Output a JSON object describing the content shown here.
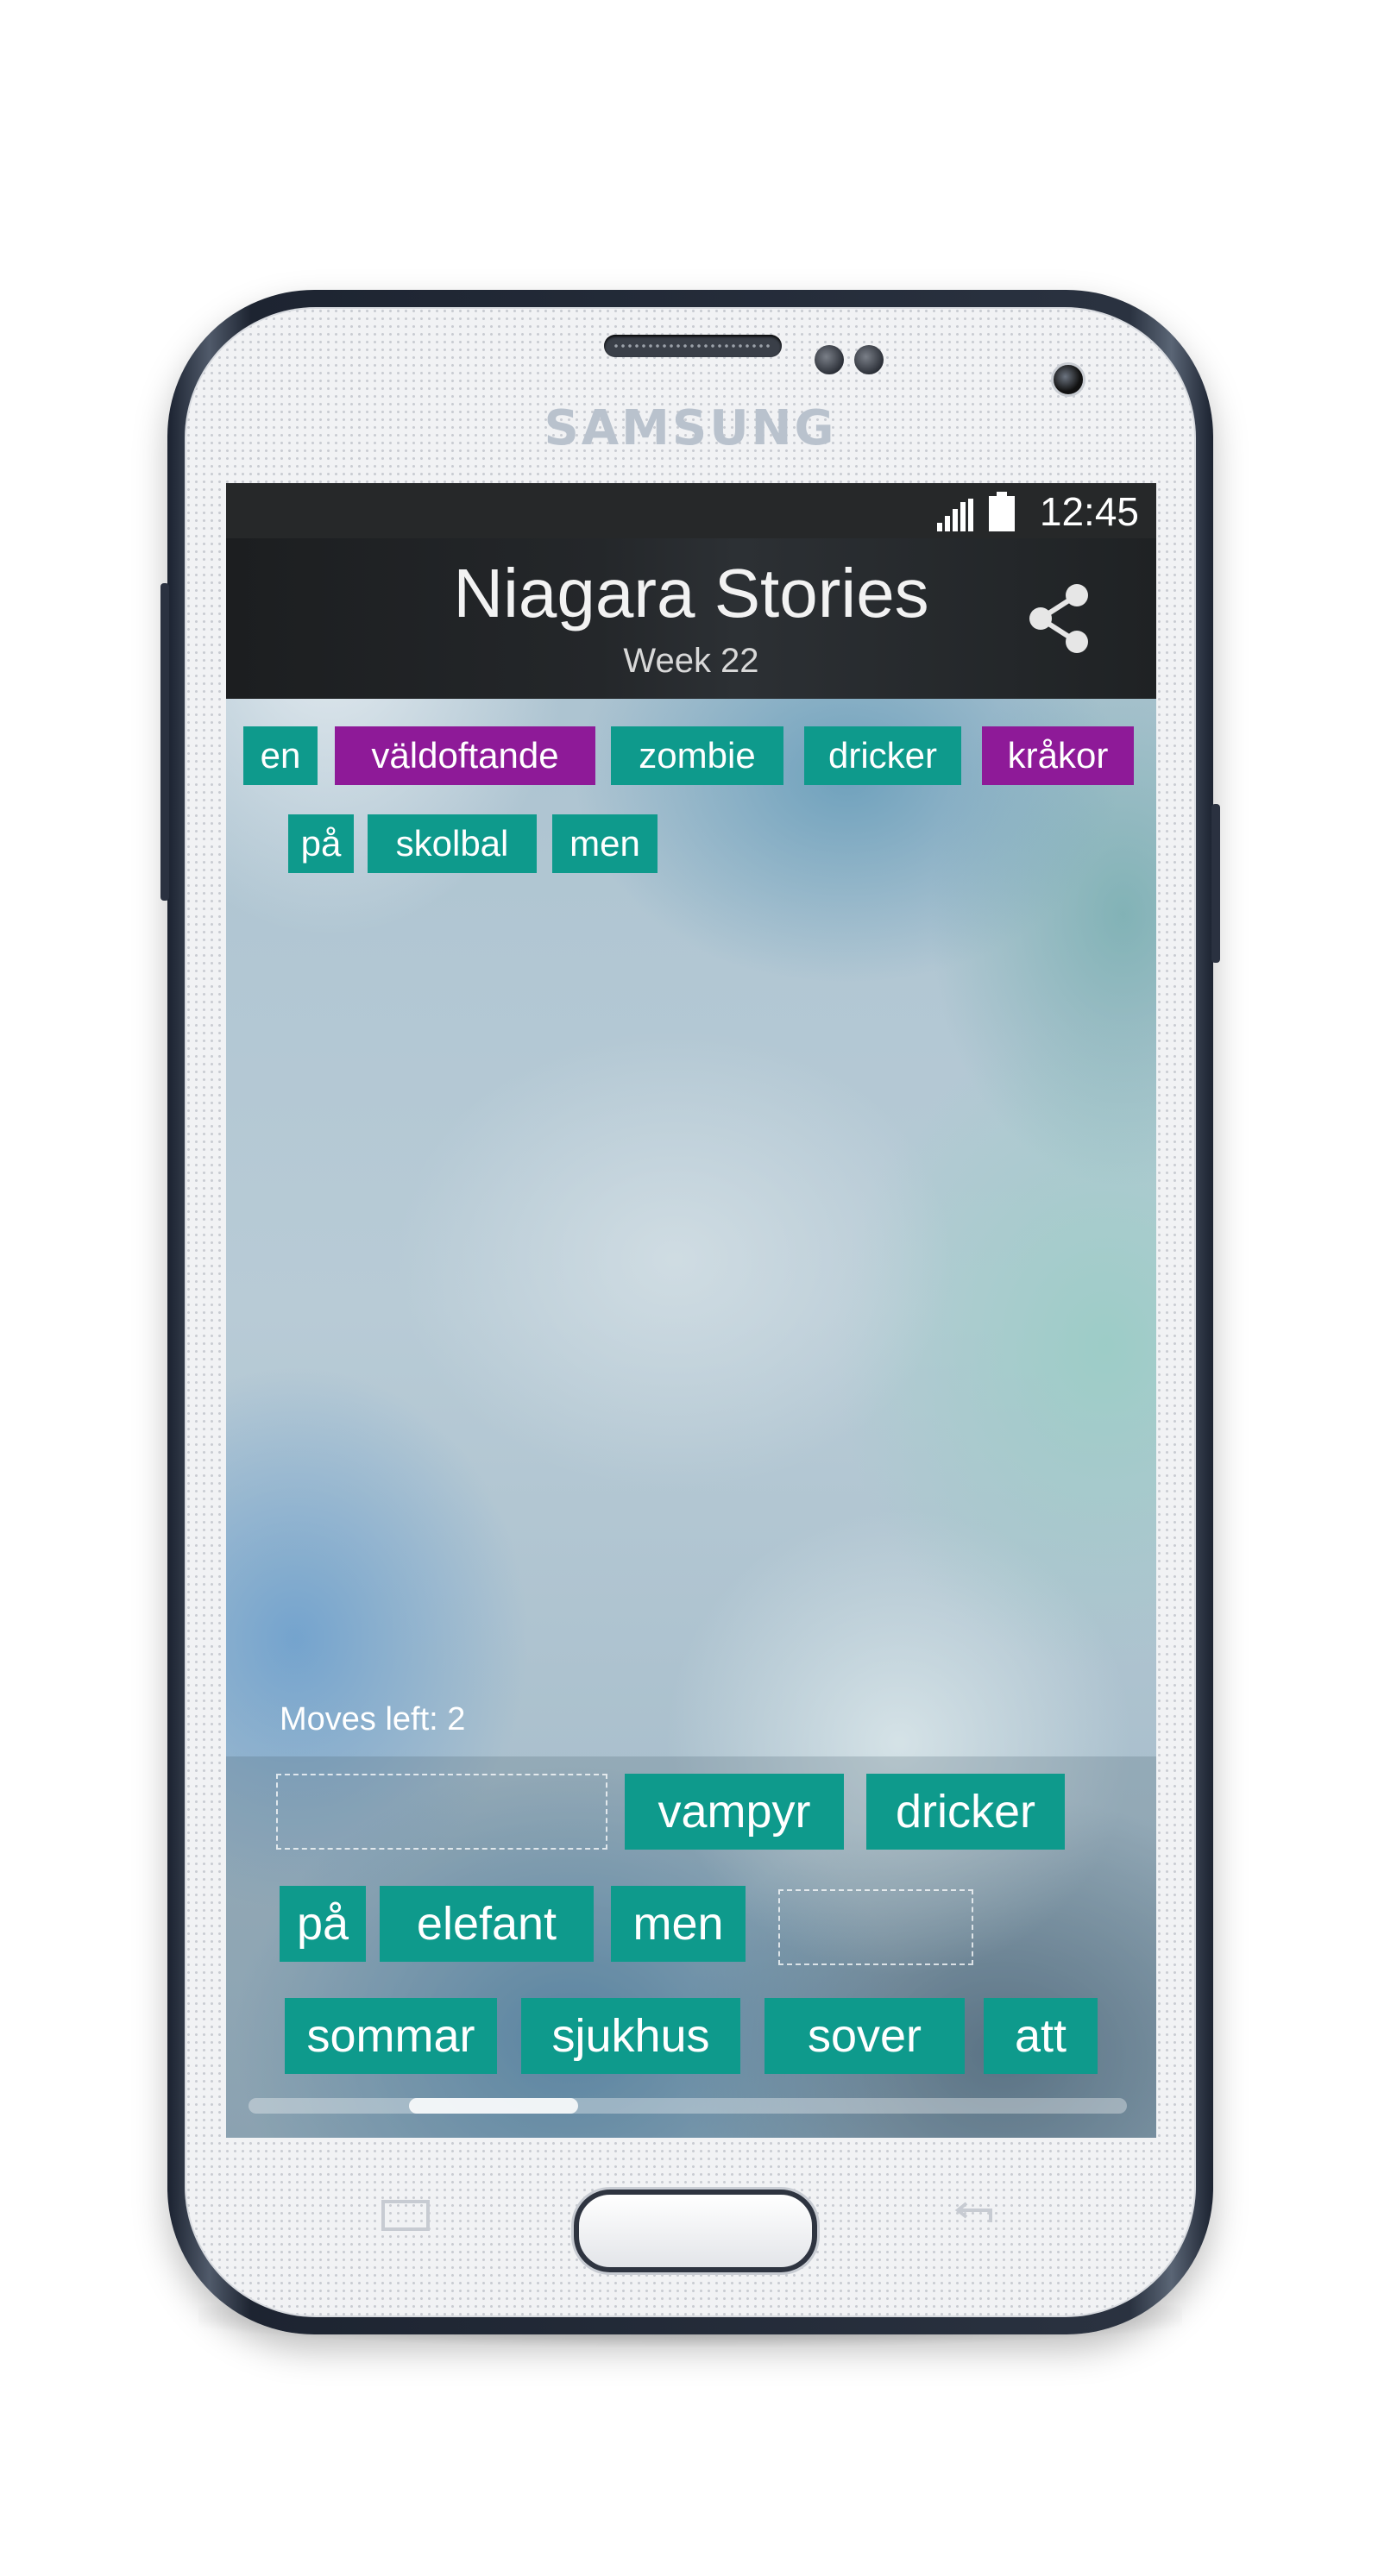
{
  "device": {
    "brand": "SAMSUNG"
  },
  "status_bar": {
    "time": "12:45"
  },
  "app_bar": {
    "title": "Niagara Stories",
    "subtitle": "Week 22"
  },
  "sentence_words": [
    {
      "text": "en",
      "color": "#0e9a8c"
    },
    {
      "text": "väldoftande",
      "color": "#8e1a98"
    },
    {
      "text": "zombie",
      "color": "#0e9a8c"
    },
    {
      "text": "dricker",
      "color": "#0e9a8c"
    },
    {
      "text": "kråkor",
      "color": "#8e1a98"
    },
    {
      "text": "på",
      "color": "#0e9a8c"
    },
    {
      "text": "skolbal",
      "color": "#0e9a8c"
    },
    {
      "text": "men",
      "color": "#0e9a8c"
    }
  ],
  "moves_left": "Moves left: 2",
  "word_tray": [
    {
      "text": ""
    },
    {
      "text": "vampyr"
    },
    {
      "text": "dricker"
    },
    {
      "text": "på"
    },
    {
      "text": "elefant"
    },
    {
      "text": "men"
    },
    {
      "text": ""
    },
    {
      "text": "sommar"
    },
    {
      "text": "sjukhus"
    },
    {
      "text": "sover"
    },
    {
      "text": "att"
    }
  ],
  "colors": {
    "teal": "#0e9a8c",
    "purple": "#8e1a98",
    "app_bar": "#222528",
    "status_bar": "#262829"
  }
}
